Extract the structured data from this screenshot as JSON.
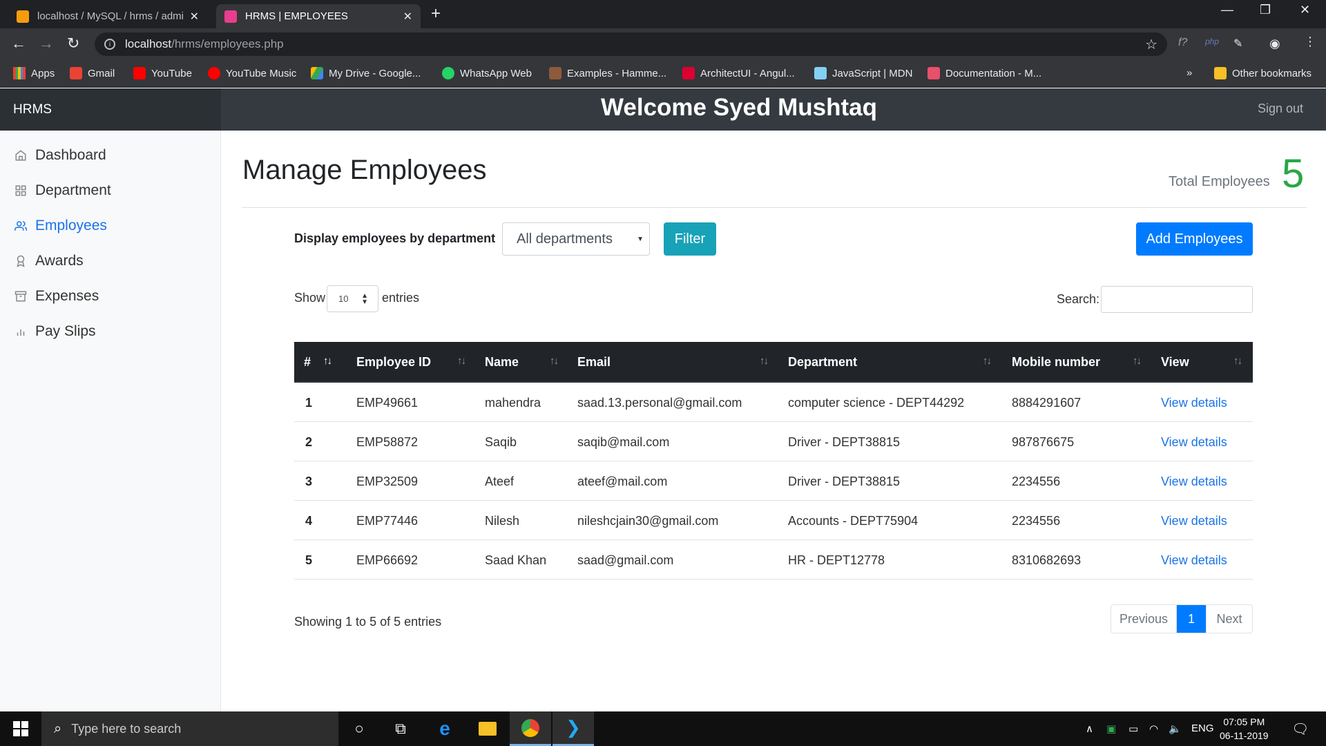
{
  "browser": {
    "tabs": [
      {
        "label": "localhost / MySQL / hrms / admi",
        "active": false
      },
      {
        "label": "HRMS | EMPLOYEES",
        "active": true
      }
    ],
    "url_host": "localhost",
    "url_path": "/hrms/employees.php",
    "bookmarks": [
      "Apps",
      "Gmail",
      "YouTube",
      "YouTube Music",
      "My Drive - Google...",
      "WhatsApp Web",
      "Examples - Hamme...",
      "ArchitectUI - Angul...",
      "JavaScript | MDN",
      "Documentation - M..."
    ],
    "bookmarks_overflow": "»",
    "other_bookmarks": "Other bookmarks"
  },
  "header": {
    "brand": "HRMS",
    "welcome": "Welcome Syed Mushtaq",
    "signout": "Sign out"
  },
  "sidebar": {
    "items": [
      {
        "label": "Dashboard",
        "icon": "home-icon",
        "active": false
      },
      {
        "label": "Department",
        "icon": "grid-icon",
        "active": false
      },
      {
        "label": "Employees",
        "icon": "users-icon",
        "active": true
      },
      {
        "label": "Awards",
        "icon": "award-icon",
        "active": false
      },
      {
        "label": "Expenses",
        "icon": "archive-icon",
        "active": false
      },
      {
        "label": "Pay Slips",
        "icon": "bar-chart-icon",
        "active": false
      }
    ]
  },
  "main": {
    "title": "Manage Employees",
    "total_label": "Total Employees",
    "total_value": "5",
    "filter_label": "Display employees by department",
    "dept_select": "All departments",
    "filter_button": "Filter",
    "add_button": "Add Employees",
    "show_label": "Show",
    "show_value": "10",
    "entries_label": "entries",
    "search_label": "Search:",
    "table": {
      "headers": [
        "#",
        "Employee ID",
        "Name",
        "Email",
        "Department",
        "Mobile number",
        "View"
      ],
      "rows": [
        [
          "1",
          "EMP49661",
          "mahendra",
          "saad.13.personal@gmail.com",
          "computer science - DEPT44292",
          "8884291607",
          "View details"
        ],
        [
          "2",
          "EMP58872",
          "Saqib",
          "saqib@mail.com",
          "Driver - DEPT38815",
          "987876675",
          "View details"
        ],
        [
          "3",
          "EMP32509",
          "Ateef",
          "ateef@mail.com",
          "Driver - DEPT38815",
          "2234556",
          "View details"
        ],
        [
          "4",
          "EMP77446",
          "Nilesh",
          "nileshcjain30@gmail.com",
          "Accounts - DEPT75904",
          "2234556",
          "View details"
        ],
        [
          "5",
          "EMP66692",
          "Saad Khan",
          "saad@gmail.com",
          "HR - DEPT12778",
          "8310682693",
          "View details"
        ]
      ]
    },
    "showing": "Showing 1 to 5 of 5 entries",
    "pagination": {
      "prev": "Previous",
      "current": "1",
      "next": "Next"
    }
  },
  "taskbar": {
    "search_placeholder": "Type here to search",
    "language": "ENG",
    "time": "07:05 PM",
    "date": "06-11-2019"
  },
  "colors": {
    "accent": "#007bff",
    "filter": "#17a2b8",
    "total": "#28a745",
    "header": "#343a40"
  }
}
